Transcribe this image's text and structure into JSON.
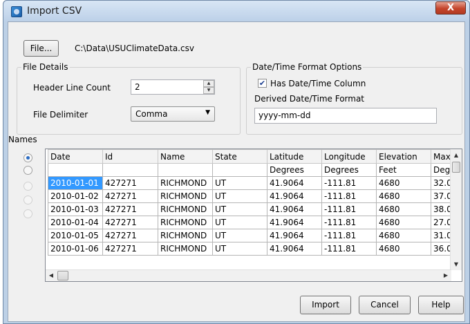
{
  "window": {
    "title": "Import CSV",
    "close_symbol": "X"
  },
  "file": {
    "button_label": "File...",
    "path": "C:\\Data\\USUClimateData.csv"
  },
  "file_details": {
    "legend": "File Details",
    "header_line_count_label": "Header Line Count",
    "header_line_count_value": "2",
    "delimiter_label": "File Delimiter",
    "delimiter_value": "Comma"
  },
  "datetime_options": {
    "legend": "Date/Time Format Options",
    "has_datetime_label": "Has Date/Time Column",
    "has_datetime_checked": true,
    "derived_format_label": "Derived Date/Time Format",
    "derived_format_value": "yyyy-mm-dd"
  },
  "names_label": "Names",
  "radios": [
    {
      "checked": true,
      "enabled": true
    },
    {
      "checked": false,
      "enabled": true
    },
    {
      "checked": false,
      "enabled": false
    },
    {
      "checked": false,
      "enabled": false
    },
    {
      "checked": false,
      "enabled": false
    }
  ],
  "grid": {
    "headers": [
      "Date",
      "Id",
      "Name",
      "State",
      "Latitude",
      "Longitude",
      "Elevation",
      "Maxir"
    ],
    "units": [
      "",
      "",
      "",
      "",
      "Degrees",
      "Degrees",
      "Feet",
      "Deg F"
    ],
    "rows": [
      [
        "2010-01-01",
        "427271",
        "RICHMOND",
        "UT",
        "41.9064",
        "-111.81",
        "4680",
        "32.0"
      ],
      [
        "2010-01-02",
        "427271",
        "RICHMOND",
        "UT",
        "41.9064",
        "-111.81",
        "4680",
        "37.0"
      ],
      [
        "2010-01-03",
        "427271",
        "RICHMOND",
        "UT",
        "41.9064",
        "-111.81",
        "4680",
        "38.0"
      ],
      [
        "2010-01-04",
        "427271",
        "RICHMOND",
        "UT",
        "41.9064",
        "-111.81",
        "4680",
        "27.0"
      ],
      [
        "2010-01-05",
        "427271",
        "RICHMOND",
        "UT",
        "41.9064",
        "-111.81",
        "4680",
        "31.0"
      ],
      [
        "2010-01-06",
        "427271",
        "RICHMOND",
        "UT",
        "41.9064",
        "-111.81",
        "4680",
        "36.0"
      ]
    ],
    "selected_cell": "2010-01-01"
  },
  "buttons": {
    "import": "Import",
    "cancel": "Cancel",
    "help": "Help"
  },
  "colors": {
    "selection": "#3399ff",
    "title_bar": "#bcd0e8",
    "close_button": "#c4452c"
  }
}
